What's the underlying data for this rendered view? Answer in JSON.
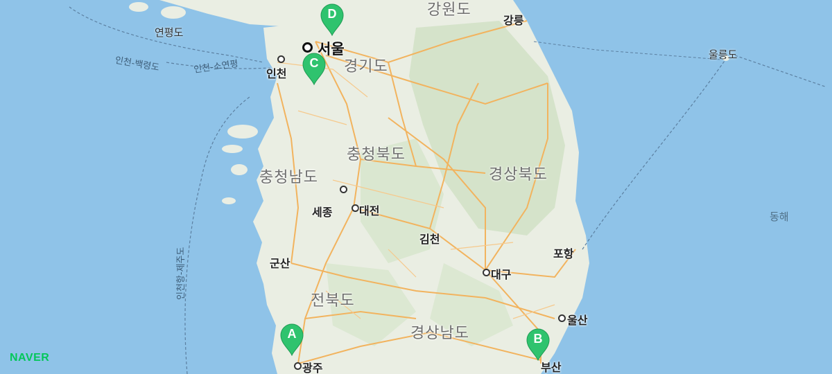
{
  "provinces": {
    "gangwon": "강원도",
    "gyeonggi": "경기도",
    "chungbuk": "충청북도",
    "chungnam": "충청남도",
    "gyeongbuk": "경상북도",
    "jeonbuk": "전북도",
    "gyeongnam": "경상남도"
  },
  "cities": {
    "seoul": "서울",
    "incheon": "인천",
    "gangneung": "강릉",
    "sejong": "세종",
    "daejeon": "대전",
    "gimcheon": "김천",
    "gunsan": "군산",
    "daegu": "대구",
    "pohang": "포항",
    "ulsan": "울산",
    "gwangju": "광주",
    "busan": "부산"
  },
  "islands": {
    "yeonpyeong": "연평도",
    "ulleung": "울릉도"
  },
  "sea": {
    "east": "동해"
  },
  "routes": {
    "incheon_baengnyeong": "인천-백령도",
    "incheon_soyeonpyeong": "인천-소연평",
    "incheon_jeju": "인천항-제주도"
  },
  "markers": [
    {
      "label": "A",
      "place": "광주"
    },
    {
      "label": "B",
      "place": "부산"
    },
    {
      "label": "C",
      "place": "인천"
    },
    {
      "label": "D",
      "place": "서울"
    }
  ],
  "brand": {
    "logo": "NAVER"
  },
  "colors": {
    "sea": "#8fc3e8",
    "land": "#eaeee3",
    "forest": "#cfe0c3",
    "highway": "#f2b35e",
    "marker": "#2fc36e",
    "brand": "#03c75a"
  }
}
